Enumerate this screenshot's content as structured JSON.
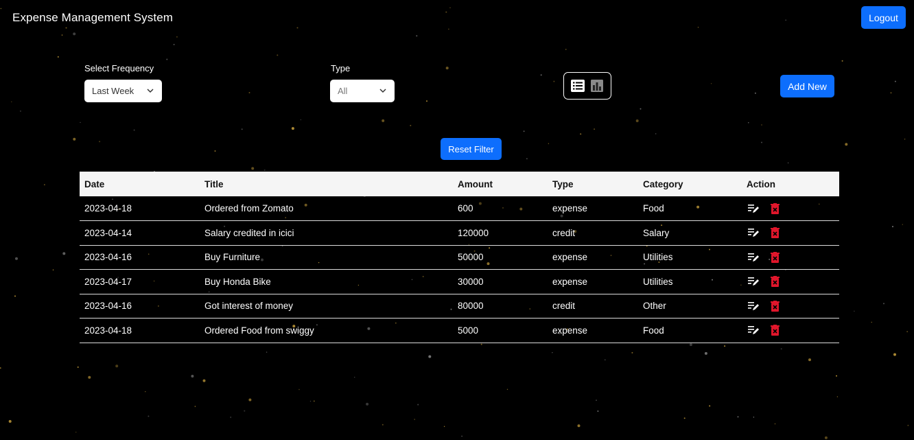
{
  "header": {
    "app_title": "Expense Management System",
    "logout_label": "Logout"
  },
  "filters": {
    "frequency_label": "Select Frequency",
    "frequency_value": "Last Week",
    "type_label": "Type",
    "type_value": "All"
  },
  "view_toggle": {
    "list_icon": "list-icon",
    "chart_icon": "bar-chart-icon"
  },
  "add_new_label": "Add New",
  "reset_filter_label": "Reset Filter",
  "table": {
    "headers": [
      "Date",
      "Title",
      "Amount",
      "Type",
      "Category",
      "Action"
    ],
    "rows": [
      {
        "date": "2023-04-18",
        "title": "Ordered from Zomato",
        "amount": "600",
        "type": "expense",
        "category": "Food"
      },
      {
        "date": "2023-04-14",
        "title": "Salary credited in icici",
        "amount": "120000",
        "type": "credit",
        "category": "Salary"
      },
      {
        "date": "2023-04-16",
        "title": "Buy Furniture",
        "amount": "50000",
        "type": "expense",
        "category": "Utilities"
      },
      {
        "date": "2023-04-17",
        "title": "Buy Honda Bike",
        "amount": "30000",
        "type": "expense",
        "category": "Utilities"
      },
      {
        "date": "2023-04-16",
        "title": "Got interest of money",
        "amount": "80000",
        "type": "credit",
        "category": "Other"
      },
      {
        "date": "2023-04-18",
        "title": "Ordered Food from swiggy",
        "amount": "5000",
        "type": "expense",
        "category": "Food"
      }
    ],
    "action_icons": [
      "edit-icon",
      "delete-icon"
    ]
  },
  "colors": {
    "background": "#000000",
    "primary": "#0d6efd",
    "delete": "#e0162b",
    "star": "#c8a03c"
  }
}
